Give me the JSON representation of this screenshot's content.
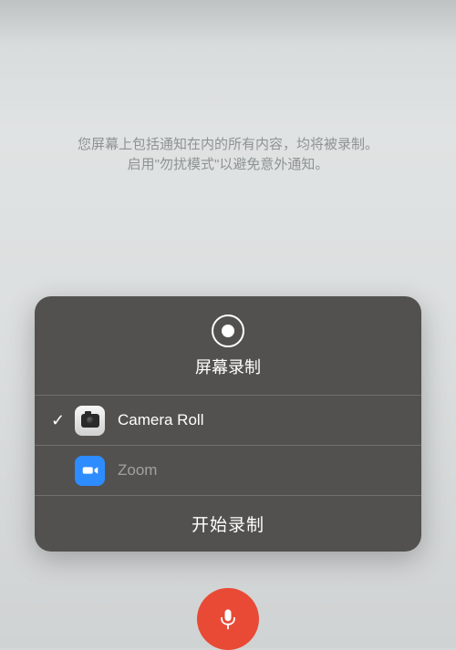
{
  "info": {
    "line1": "您屏幕上包括通知在内的所有内容，均将被录制。",
    "line2": "启用\"勿扰模式\"以避免意外通知。"
  },
  "sheet": {
    "title": "屏幕录制",
    "options": [
      {
        "label": "Camera Roll",
        "selected": true,
        "icon": "photos-icon"
      },
      {
        "label": "Zoom",
        "selected": false,
        "icon": "zoom-icon"
      }
    ],
    "start_label": "开始录制"
  },
  "mic_button": {
    "label": "麦克风"
  }
}
